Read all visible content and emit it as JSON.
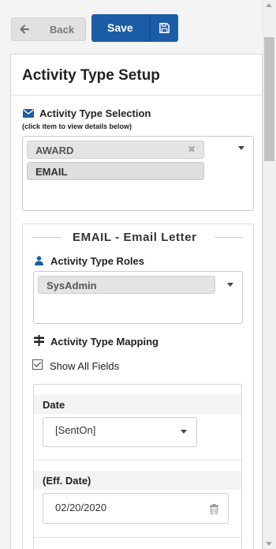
{
  "toolbar": {
    "back_label": "Back",
    "save_label": "Save"
  },
  "panel": {
    "title": "Activity Type Setup",
    "selection_label": "Activity Type Selection",
    "selection_hint": "(click item to view details below)",
    "selected_types": [
      "AWARD",
      "EMAIL"
    ]
  },
  "detail": {
    "title": "EMAIL - Email Letter",
    "roles_label": "Activity Type Roles",
    "roles": [
      "SysAdmin"
    ],
    "mapping_label": "Activity Type Mapping",
    "show_all_fields_label": "Show All Fields",
    "show_all_fields_checked": true,
    "fields": [
      {
        "label": "Date",
        "value": "[SentOn]"
      },
      {
        "label": "(Eff. Date)",
        "value": "02/20/2020"
      }
    ]
  },
  "colors": {
    "primary": "#1a5da6",
    "annotation_arrow": "#4a6fe0",
    "panel_bg": "#ffffff",
    "page_bg": "#f4f4f4"
  },
  "icons": [
    "arrow-left-icon",
    "floppy-disk-icon",
    "envelope-icon",
    "user-icon",
    "signpost-icon",
    "trash-icon",
    "remove-x-icon"
  ]
}
